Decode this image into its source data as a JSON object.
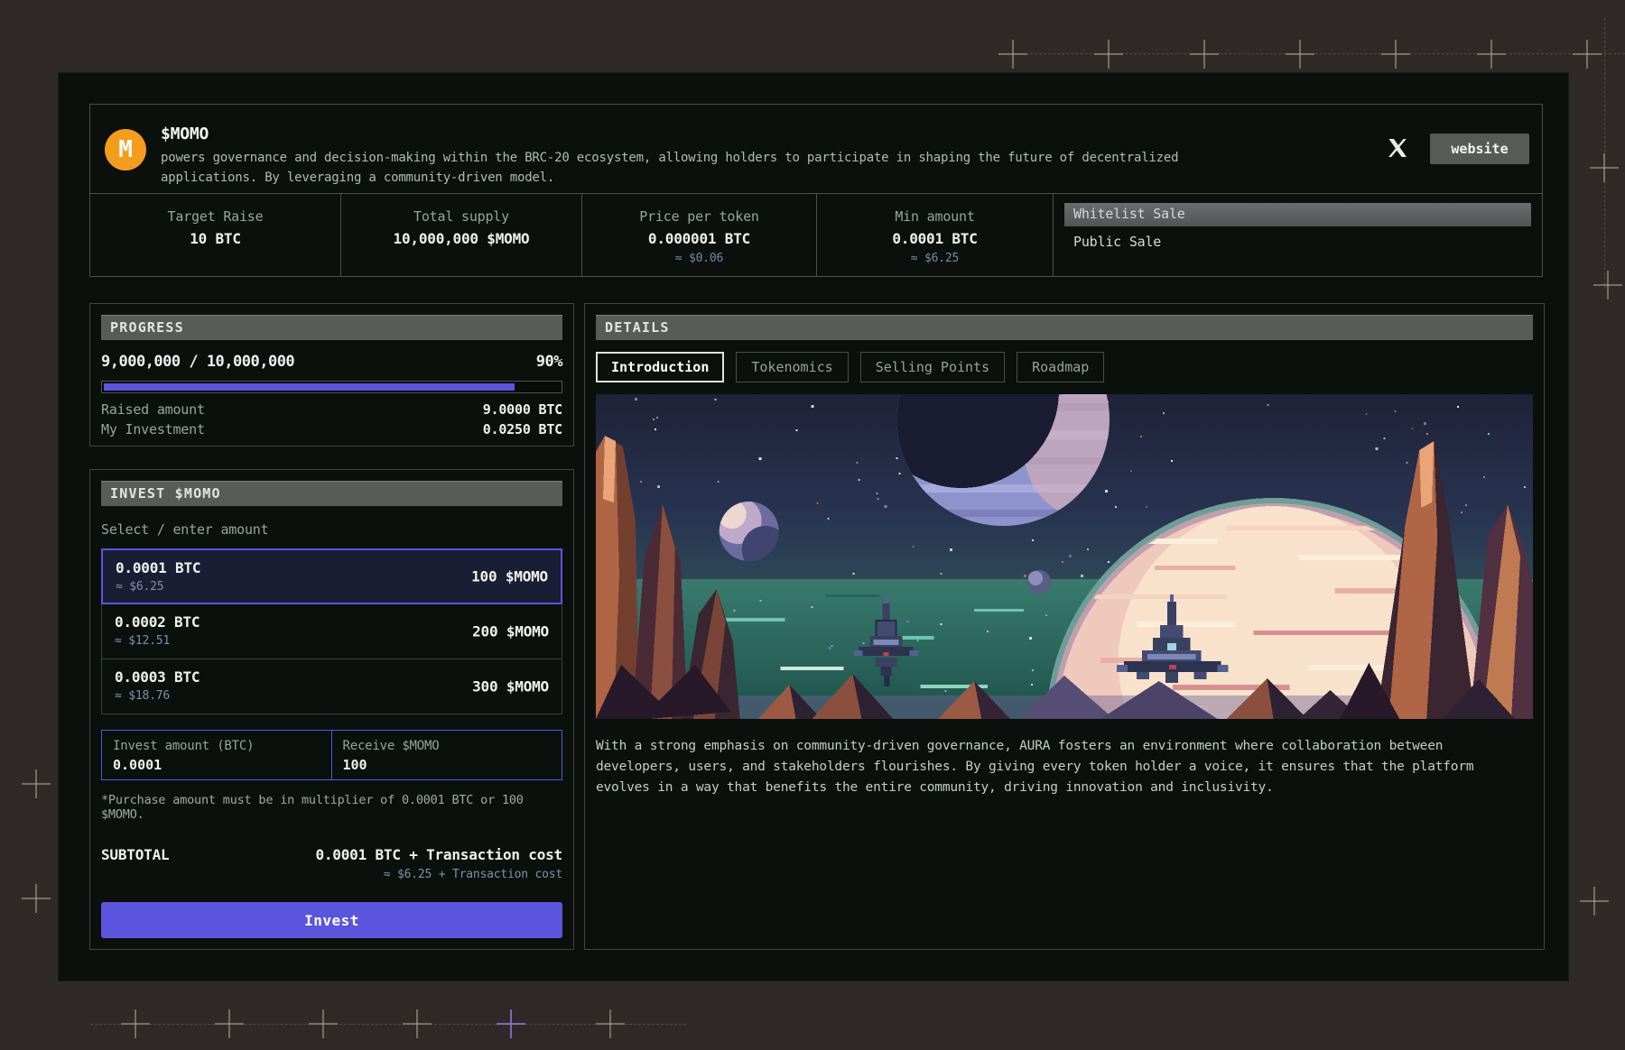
{
  "header": {
    "logo_letter": "M",
    "token_symbol": "$MOMO",
    "description": "powers governance and decision-making within the BRC-20 ecosystem, allowing holders to participate in shaping the future of decentralized applications. By leveraging a community-driven model.",
    "website_label": "website"
  },
  "stats": {
    "items": [
      {
        "label": "Target Raise",
        "value": "10 BTC",
        "sub": ""
      },
      {
        "label": "Total supply",
        "value": "10,000,000 $MOMO",
        "sub": ""
      },
      {
        "label": "Price per token",
        "value": "0.000001 BTC",
        "sub": "≈ $0.06"
      },
      {
        "label": "Min amount",
        "value": "0.0001 BTC",
        "sub": "≈ $6.25"
      }
    ]
  },
  "sale_phases": {
    "active": "Whitelist Sale",
    "inactive": "Public Sale"
  },
  "progress": {
    "title": "PROGRESS",
    "ratio": "9,000,000 / 10,000,000",
    "percent": "90%",
    "percent_value": 90,
    "raised_label": "Raised amount",
    "raised_value": "9.0000 BTC",
    "investment_label": "My Investment",
    "investment_value": "0.0250 BTC"
  },
  "invest": {
    "title": "INVEST $MOMO",
    "select_label": "Select / enter amount",
    "options": [
      {
        "btc": "0.0001 BTC",
        "usd": "≈ $6.25",
        "momo": "100 $MOMO"
      },
      {
        "btc": "0.0002 BTC",
        "usd": "≈ $12.51",
        "momo": "200 $MOMO"
      },
      {
        "btc": "0.0003 BTC",
        "usd": "≈ $18.76",
        "momo": "300 $MOMO"
      }
    ],
    "invest_input": {
      "label": "Invest amount (BTC)",
      "value": "0.0001"
    },
    "receive_input": {
      "label": "Receive $MOMO",
      "value": "100"
    },
    "note": "*Purchase amount must be in multiplier of 0.0001 BTC or 100 $MOMO.",
    "subtotal_label": "SUBTOTAL",
    "subtotal_value": "0.0001 BTC + Transaction cost",
    "subtotal_usd": "≈ $6.25 + Transaction cost",
    "button_label": "Invest"
  },
  "details": {
    "title": "DETAILS",
    "tabs": [
      {
        "label": "Introduction"
      },
      {
        "label": "Tokenomics"
      },
      {
        "label": "Selling Points"
      },
      {
        "label": "Roadmap"
      }
    ],
    "body": "With a strong emphasis on community-driven governance, AURA fosters an environment where collaboration between developers, users, and stakeholders flourishes. By giving every token holder a voice, it ensures that the platform evolves in a way that benefits the entire community, driving innovation and inclusivity."
  },
  "colors": {
    "accent": "#5b55dd",
    "logo_orange": "#f49d1d",
    "page_background": "#2f2a27",
    "card_background": "#0b100d"
  }
}
